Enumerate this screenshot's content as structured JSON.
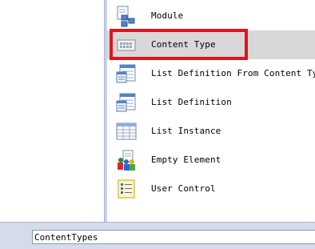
{
  "templates": {
    "items": [
      {
        "label": "Module",
        "icon": "module-icon"
      },
      {
        "label": "Content Type",
        "icon": "content-type-icon",
        "selected": true
      },
      {
        "label": "List Definition From Content Type",
        "icon": "list-definition-from-content-type-icon"
      },
      {
        "label": "List Definition",
        "icon": "list-definition-icon"
      },
      {
        "label": "List Instance",
        "icon": "list-instance-icon"
      },
      {
        "label": "Empty Element",
        "icon": "empty-element-icon"
      },
      {
        "label": "User Control",
        "icon": "user-control-icon"
      }
    ]
  },
  "name_field": {
    "value": "ContentTypes"
  },
  "colors": {
    "highlight_outline": "#e0141c",
    "selected_background": "#d8d8d8",
    "bottom_bar": "#d6dbe9"
  }
}
